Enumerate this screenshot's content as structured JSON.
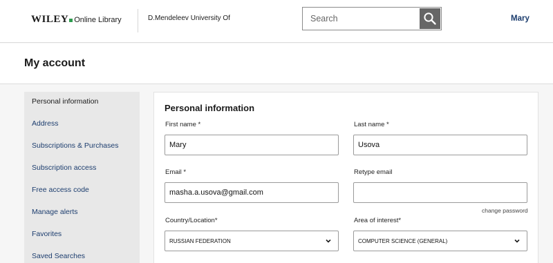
{
  "header": {
    "brand": "WILEY",
    "brand_sub": "Online Library",
    "institution": "D.Mendeleev University Of",
    "search_placeholder": "Search",
    "user_name": "Mary"
  },
  "page": {
    "title": "My account"
  },
  "sidebar": {
    "items": [
      {
        "label": "Personal information",
        "active": true
      },
      {
        "label": "Address"
      },
      {
        "label": "Subscriptions & Purchases"
      },
      {
        "label": "Subscription access"
      },
      {
        "label": "Free access code"
      },
      {
        "label": "Manage alerts"
      },
      {
        "label": "Favorites"
      },
      {
        "label": "Saved Searches"
      }
    ]
  },
  "form": {
    "section_title": "Personal information",
    "first_name": {
      "label": "First name *",
      "value": "Mary"
    },
    "last_name": {
      "label": "Last name *",
      "value": "Usova"
    },
    "email": {
      "label": "Email *",
      "value": "masha.a.usova@gmail.com"
    },
    "retype_email": {
      "label": "Retype email",
      "value": ""
    },
    "change_password": "change password",
    "country": {
      "label": "Country/Location*",
      "value": "RUSSIAN FEDERATION"
    },
    "area_of_interest": {
      "label": "Area of interest*",
      "value": "COMPUTER SCIENCE (GENERAL)"
    }
  },
  "colors": {
    "link": "#1c3d6e",
    "sidebar_bg": "#e8e8e8",
    "search_button": "#666666",
    "brand_dot": "#2e9c4e"
  }
}
